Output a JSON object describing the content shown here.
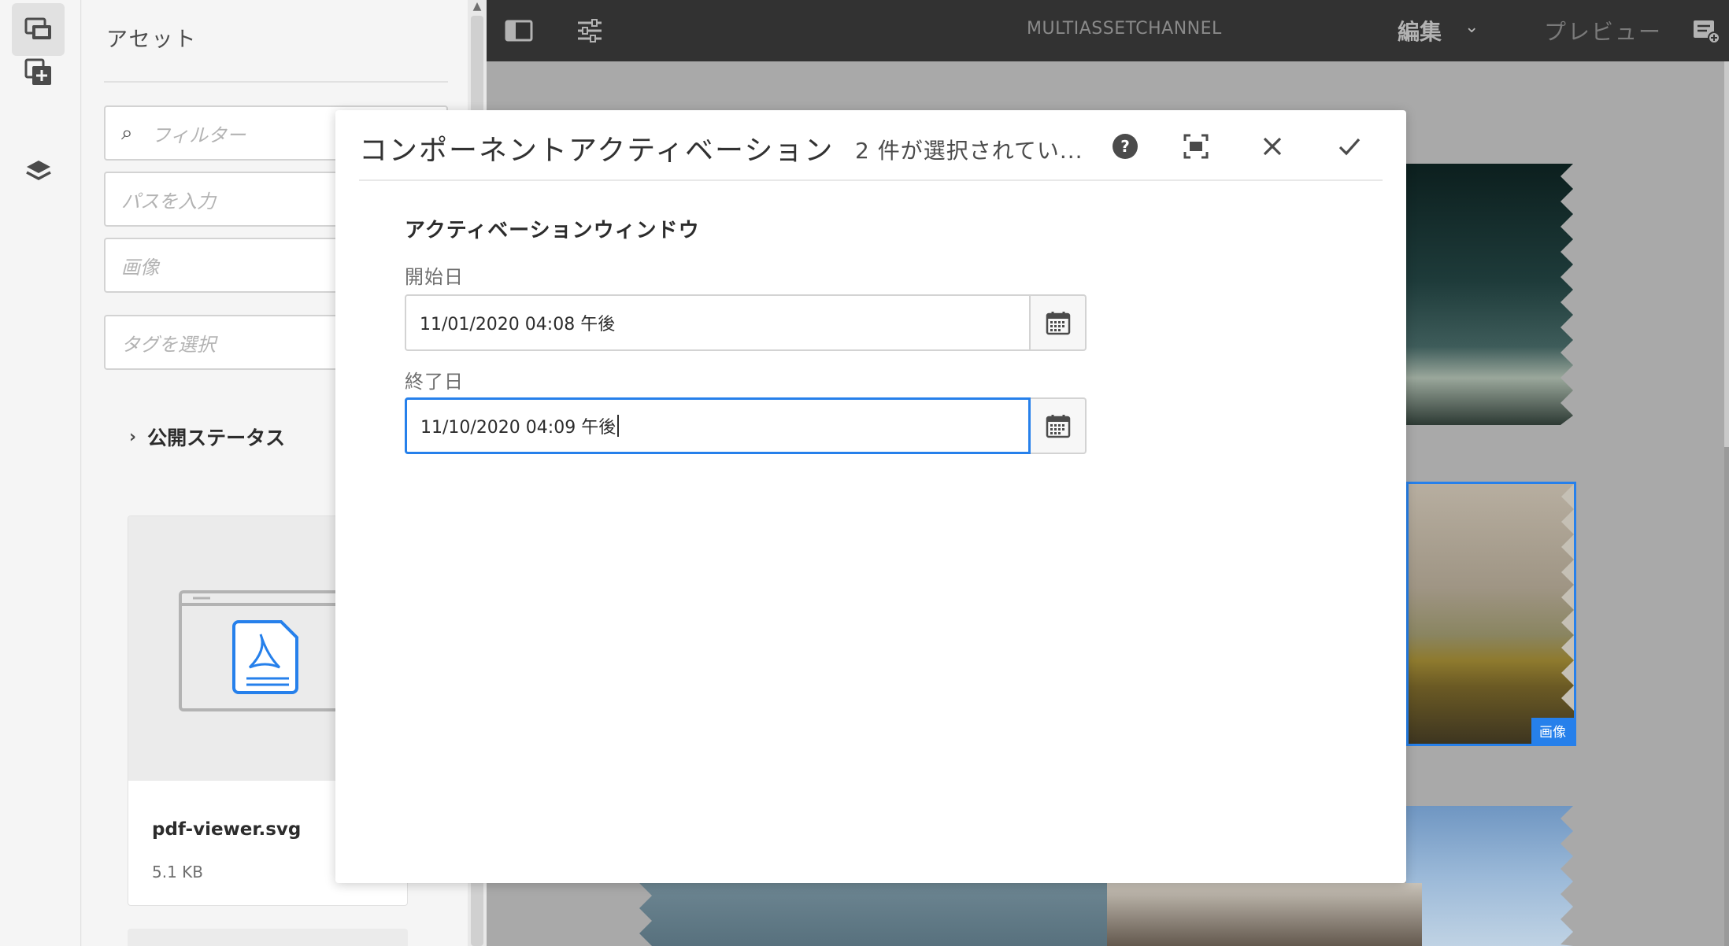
{
  "panel": {
    "title": "アセット",
    "filter_placeholder": "フィルター",
    "path_placeholder": "パスを入力",
    "type_placeholder": "画像",
    "tag_placeholder": "タグを選択",
    "status_label": "公開ステータス",
    "asset": {
      "name": "pdf-viewer.svg",
      "size": "5.1 KB"
    }
  },
  "topbar": {
    "title": "MULTIASSETCHANNEL",
    "mode": "編集",
    "preview": "プレビュー"
  },
  "canvas": {
    "selected_badge": "画像"
  },
  "dialog": {
    "title": "コンポーネントアクティベーション",
    "subtitle": "2 件が選択されてい...",
    "section": "アクティベーションウィンドウ",
    "start_label": "開始日",
    "start_value": "11/01/2020 04:08 午後",
    "end_label": "終了日",
    "end_value": "11/10/2020 04:09 午後"
  },
  "colors": {
    "accent": "#2680eb",
    "topbar": "#323232"
  }
}
